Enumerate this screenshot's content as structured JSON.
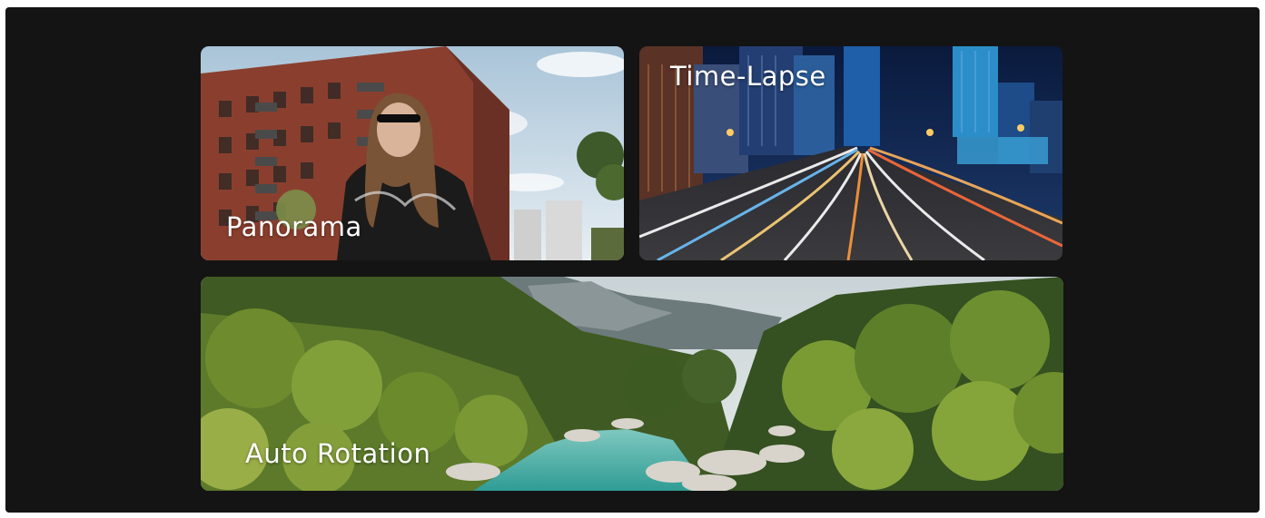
{
  "cards": [
    {
      "id": "panorama",
      "label": "Panorama"
    },
    {
      "id": "timelapse",
      "label": "Time-Lapse"
    },
    {
      "id": "rotation",
      "label": "Auto Rotation"
    }
  ],
  "colors": {
    "frame_background": "#141414",
    "label_text": "#ffffff"
  }
}
